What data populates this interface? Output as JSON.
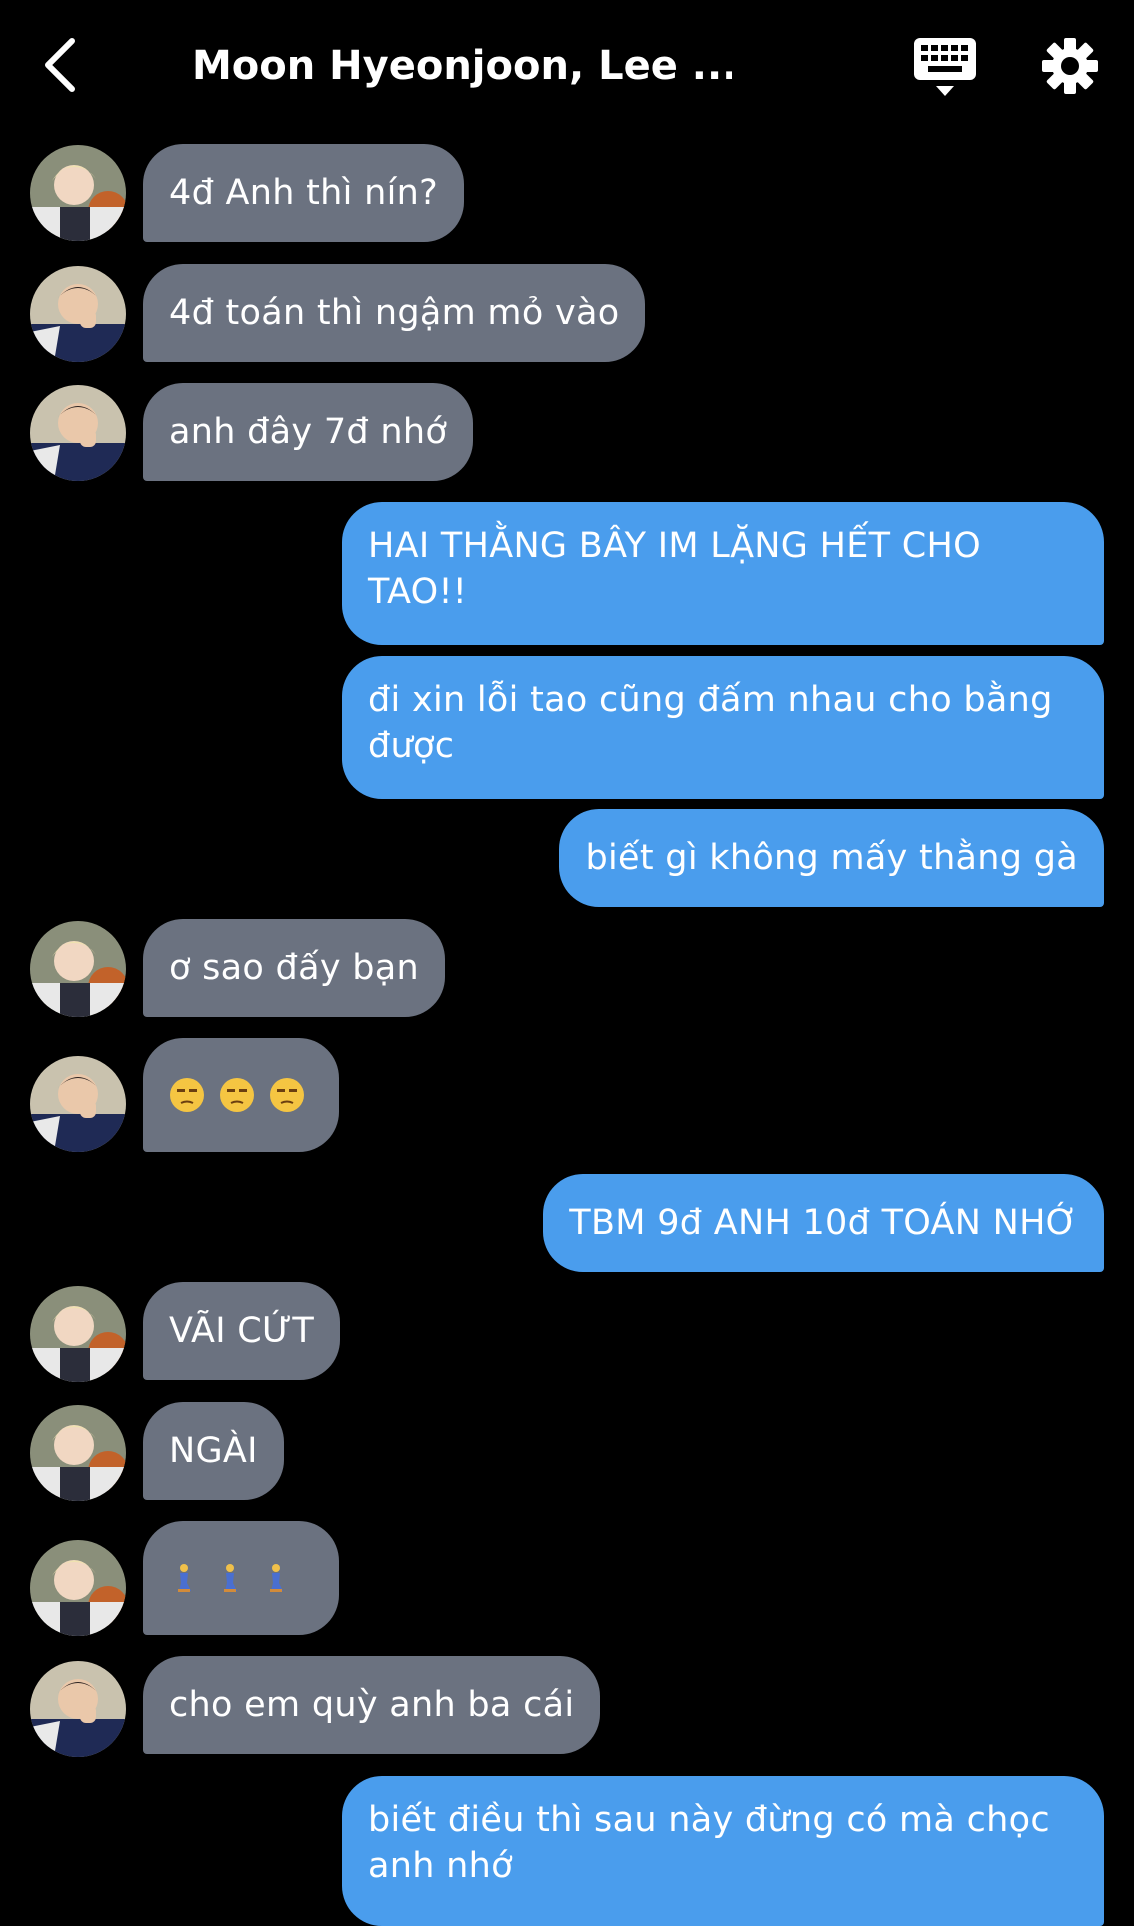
{
  "header": {
    "title": "Moon Hyeonjoon, Lee ...",
    "back_icon": "chevron-left-icon",
    "keyboard_icon": "keyboard-icon",
    "settings_icon": "gear-icon"
  },
  "colors": {
    "background": "#000000",
    "incoming_bubble": "#6b7280",
    "outgoing_bubble": "#4a9ded",
    "text": "#ffffff"
  },
  "messages": [
    {
      "side": "in",
      "sender": "blonde",
      "text": "4đ Anh thì nín?"
    },
    {
      "side": "in",
      "sender": "dark",
      "text": "4đ toán thì ngậm mỏ vào"
    },
    {
      "side": "in",
      "sender": "dark",
      "text": "anh đây 7đ nhớ"
    },
    {
      "side": "out",
      "text_line1": "HAI THẰNG BÂY IM LẶNG HẾT CHO",
      "text_line2": "TAO!!"
    },
    {
      "side": "out",
      "text_line1": "đi xin lỗi tao cũng đấm nhau cho bằng",
      "text_line2": "được"
    },
    {
      "side": "out",
      "text": "biết gì không mấy thằng gà"
    },
    {
      "side": "in",
      "sender": "blonde",
      "text": "ơ sao đấy bạn"
    },
    {
      "side": "in",
      "sender": "dark",
      "emoji": "unamused-face x3"
    },
    {
      "side": "out",
      "text": "TBM 9đ ANH 10đ TOÁN NHỚ"
    },
    {
      "side": "in",
      "sender": "blonde",
      "text": "VÃI CỨT"
    },
    {
      "side": "in",
      "sender": "blonde",
      "text": "NGÀI"
    },
    {
      "side": "in",
      "sender": "blonde",
      "emoji": "kneeling-person x3"
    },
    {
      "side": "in",
      "sender": "dark",
      "text": "cho em quỳ anh ba cái"
    },
    {
      "side": "out",
      "text_line1": "biết điều thì sau này đừng có mà chọc",
      "text_line2": "anh nhớ"
    }
  ]
}
